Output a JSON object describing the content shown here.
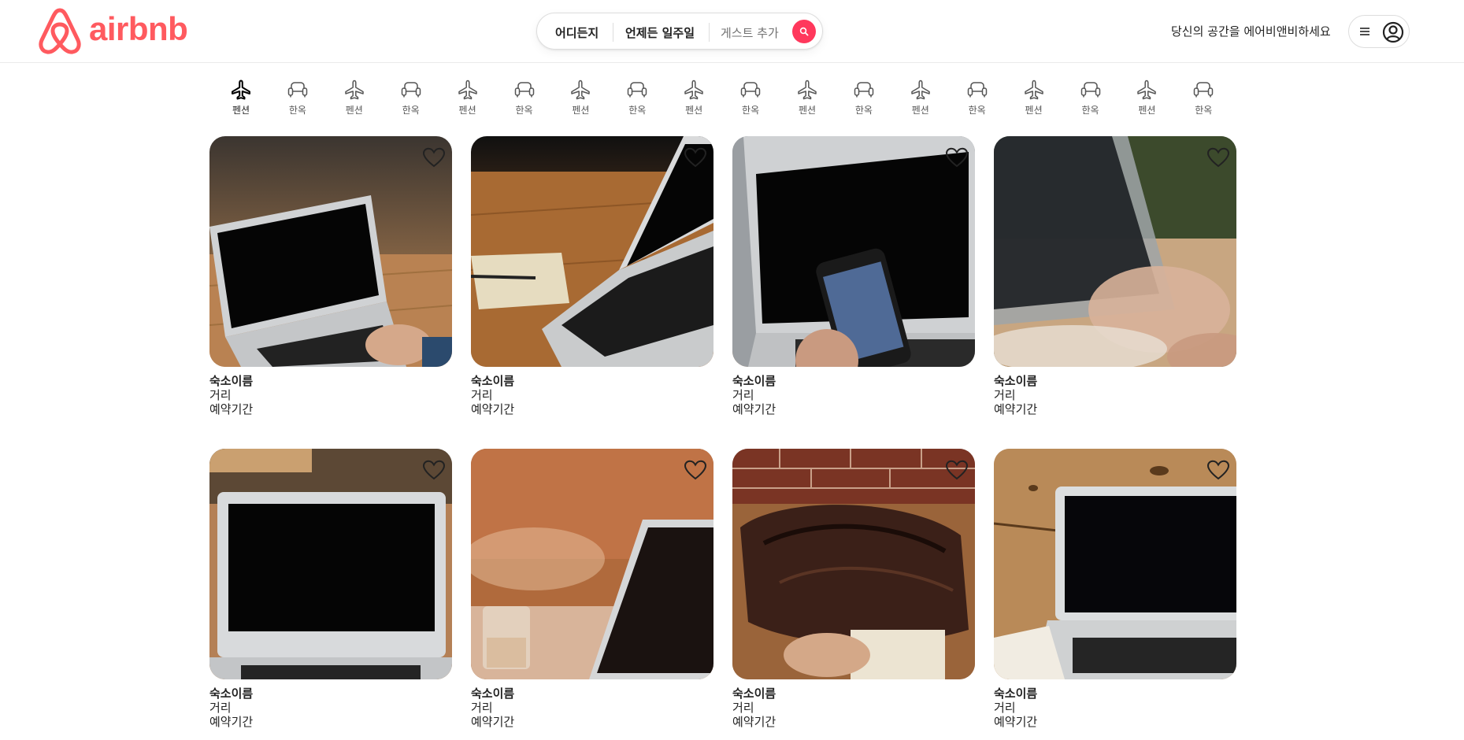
{
  "brand": {
    "name": "airbnb",
    "color": "#FF5A5F"
  },
  "search": {
    "where": "어디든지",
    "when": "언제든 일주일",
    "guests": "게스트 추가",
    "button_color": "#FF385C"
  },
  "header": {
    "host_link": "당신의 공간을 에어비앤비하세요"
  },
  "categories": [
    {
      "label": "펜션",
      "icon": "airplane-icon"
    },
    {
      "label": "한옥",
      "icon": "armchair-icon"
    },
    {
      "label": "펜션",
      "icon": "airplane-icon"
    },
    {
      "label": "한옥",
      "icon": "armchair-icon"
    },
    {
      "label": "펜션",
      "icon": "airplane-icon"
    },
    {
      "label": "한옥",
      "icon": "armchair-icon"
    },
    {
      "label": "펜션",
      "icon": "airplane-icon"
    },
    {
      "label": "한옥",
      "icon": "armchair-icon"
    },
    {
      "label": "펜션",
      "icon": "airplane-icon"
    },
    {
      "label": "한옥",
      "icon": "armchair-icon"
    },
    {
      "label": "펜션",
      "icon": "airplane-icon"
    },
    {
      "label": "한옥",
      "icon": "armchair-icon"
    },
    {
      "label": "펜션",
      "icon": "airplane-icon"
    },
    {
      "label": "한옥",
      "icon": "armchair-icon"
    },
    {
      "label": "펜션",
      "icon": "airplane-icon"
    },
    {
      "label": "한옥",
      "icon": "armchair-icon"
    },
    {
      "label": "펜션",
      "icon": "airplane-icon"
    },
    {
      "label": "한옥",
      "icon": "armchair-icon"
    }
  ],
  "listings": [
    {
      "name": "숙소이름",
      "distance": "거리",
      "dates": "예약기간"
    },
    {
      "name": "숙소이름",
      "distance": "거리",
      "dates": "예약기간"
    },
    {
      "name": "숙소이름",
      "distance": "거리",
      "dates": "예약기간"
    },
    {
      "name": "숙소이름",
      "distance": "거리",
      "dates": "예약기간"
    },
    {
      "name": "숙소이름",
      "distance": "거리",
      "dates": "예약기간"
    },
    {
      "name": "숙소이름",
      "distance": "거리",
      "dates": "예약기간"
    },
    {
      "name": "숙소이름",
      "distance": "거리",
      "dates": "예약기간"
    },
    {
      "name": "숙소이름",
      "distance": "거리",
      "dates": "예약기간"
    }
  ]
}
